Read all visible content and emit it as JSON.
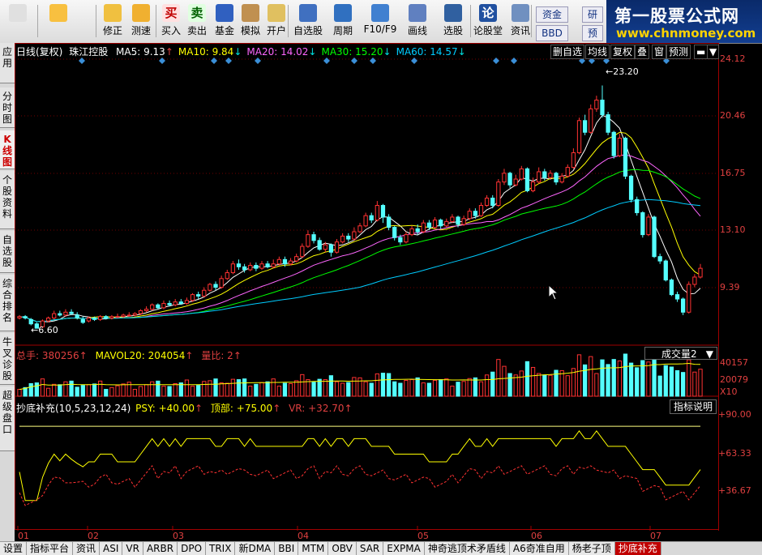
{
  "toolbar": {
    "buttons": [
      {
        "label": "",
        "icon": "home-icon"
      },
      {
        "label": "",
        "icon": "back-arrow-icon"
      },
      {
        "label": "修正",
        "icon": "up-down-arrows-icon"
      },
      {
        "label": "测速",
        "icon": "speed-dial-icon"
      },
      {
        "label": "买入",
        "icon": "buy-icon",
        "glyph": "买"
      },
      {
        "label": "卖出",
        "icon": "sell-icon",
        "glyph": "卖"
      },
      {
        "label": "基金",
        "icon": "fund-icon"
      },
      {
        "label": "模拟",
        "icon": "hammer-icon"
      },
      {
        "label": "开户",
        "icon": "lock-icon"
      },
      {
        "label": "自选股",
        "icon": "star-icon"
      },
      {
        "label": "周期",
        "icon": "clock-icon"
      },
      {
        "label": "F10/F9",
        "icon": "f10-icon"
      },
      {
        "label": "画线",
        "icon": "pencil-icon"
      },
      {
        "label": "选股",
        "icon": "screen-icon"
      },
      {
        "label": "论股堂",
        "icon": "forum-icon",
        "glyph": "论"
      },
      {
        "label": "资讯",
        "icon": "news-icon"
      }
    ],
    "chips": [
      "资金",
      "BBD",
      "研",
      "预"
    ]
  },
  "brand": {
    "title": "第一股票公式网",
    "url": "www.chnmoney.com"
  },
  "left_tabs": [
    "应用",
    "分时图",
    "K线图",
    "个股资料",
    "自选股",
    "综合排名",
    "牛叉诊股",
    "超级盘口"
  ],
  "main_panel": {
    "title": "日线(复权)",
    "stock": "珠江控股",
    "ma": [
      {
        "label": "MA5: 9.13",
        "color": "#ffffff"
      },
      {
        "label": "MA10: 9.84",
        "color": "#ffff00"
      },
      {
        "label": "MA20: 14.02",
        "color": "#ff66ff"
      },
      {
        "label": "MA30: 15.20",
        "color": "#00ff00"
      },
      {
        "label": "MA60: 14.57",
        "color": "#00ccff"
      }
    ],
    "options": [
      "删自选",
      "均线",
      "复权",
      "叠",
      "窗",
      "预测"
    ],
    "high_label": "23.20",
    "low_label": "6.60",
    "y_ticks": [
      "24.12",
      "20.46",
      "16.75",
      "13.10",
      "9.39"
    ]
  },
  "volume_panel": {
    "total": "总手: 380256",
    "mavol": "MAVOL20: 204054",
    "ratio": "量比: 2",
    "dropdown": "成交量2",
    "y_ticks": [
      "40157",
      "20079",
      "X10"
    ]
  },
  "indicator_panel": {
    "name": "抄底补充(10,5,23,12,24)",
    "psy": "PSY: +40.00",
    "top": "顶部: +75.00",
    "vr": "VR: +32.70",
    "help": "指标说明",
    "y_ticks": [
      "+90.00",
      "+63.33",
      "+36.67"
    ]
  },
  "x_labels": [
    "01",
    "02",
    "03",
    "04",
    "05",
    "06",
    "07"
  ],
  "bottom_tabs": [
    "设置",
    "指标平台",
    "资讯",
    "ASI",
    "VR",
    "ARBR",
    "DPO",
    "TRIX",
    "新DMA",
    "BBI",
    "MTM",
    "OBV",
    "SAR",
    "EXPMA",
    "神奇逃顶术矛盾线",
    "A6奇准自用",
    "杨老子顶",
    "抄底补充"
  ],
  "active_bottom_tab": "抄底补充",
  "chart_data": {
    "type": "candlestick",
    "ylim": [
      5.5,
      25.0
    ],
    "candles": [
      [
        7.3,
        7.4,
        7.5,
        7.2
      ],
      [
        7.4,
        7.3,
        7.5,
        7.2
      ],
      [
        7.2,
        6.9,
        7.3,
        6.8
      ],
      [
        6.9,
        6.6,
        7.0,
        6.6
      ],
      [
        6.7,
        7.1,
        7.2,
        6.6
      ],
      [
        7.1,
        7.3,
        7.4,
        7.0
      ],
      [
        7.3,
        7.6,
        7.8,
        7.2
      ],
      [
        7.6,
        7.5,
        7.8,
        7.4
      ],
      [
        7.5,
        7.7,
        7.9,
        7.4
      ],
      [
        7.7,
        7.6,
        7.9,
        7.5
      ],
      [
        7.5,
        7.3,
        7.7,
        7.2
      ],
      [
        7.2,
        7.0,
        7.4,
        6.9
      ],
      [
        7.1,
        7.3,
        7.4,
        7.0
      ],
      [
        7.3,
        7.2,
        7.4,
        7.1
      ],
      [
        7.2,
        7.4,
        7.5,
        7.1
      ],
      [
        7.4,
        7.3,
        7.5,
        7.2
      ],
      [
        7.3,
        7.4,
        7.5,
        7.2
      ],
      [
        7.4,
        7.4,
        7.6,
        7.3
      ],
      [
        7.4,
        7.5,
        7.6,
        7.3
      ],
      [
        7.5,
        7.5,
        7.7,
        7.4
      ],
      [
        7.5,
        7.6,
        7.7,
        7.4
      ],
      [
        7.6,
        7.8,
        7.9,
        7.5
      ],
      [
        7.8,
        7.9,
        8.1,
        7.7
      ],
      [
        7.9,
        8.2,
        8.3,
        7.8
      ],
      [
        8.2,
        8.0,
        8.3,
        7.9
      ],
      [
        8.0,
        8.3,
        8.5,
        7.9
      ],
      [
        8.3,
        8.2,
        8.5,
        8.1
      ],
      [
        8.2,
        8.4,
        8.6,
        8.1
      ],
      [
        8.4,
        8.3,
        8.6,
        8.2
      ],
      [
        8.3,
        8.5,
        8.7,
        8.2
      ],
      [
        8.5,
        8.9,
        9.0,
        8.4
      ],
      [
        8.9,
        8.8,
        9.1,
        8.6
      ],
      [
        8.8,
        9.2,
        9.4,
        8.7
      ],
      [
        9.2,
        9.6,
        9.7,
        9.1
      ],
      [
        9.6,
        9.4,
        9.8,
        9.2
      ],
      [
        9.4,
        10.0,
        10.2,
        9.3
      ],
      [
        10.0,
        10.4,
        10.6,
        9.9
      ],
      [
        10.4,
        11.0,
        11.2,
        10.3
      ],
      [
        11.0,
        10.8,
        11.3,
        10.6
      ],
      [
        10.8,
        10.6,
        11.0,
        10.4
      ],
      [
        10.6,
        10.9,
        11.1,
        10.5
      ],
      [
        10.9,
        10.7,
        11.1,
        10.5
      ],
      [
        10.7,
        11.0,
        11.2,
        10.6
      ],
      [
        11.0,
        10.8,
        11.2,
        10.7
      ],
      [
        10.8,
        11.0,
        11.3,
        10.7
      ],
      [
        11.0,
        11.3,
        11.5,
        10.9
      ],
      [
        11.3,
        11.0,
        11.5,
        10.8
      ],
      [
        11.0,
        11.2,
        11.4,
        10.9
      ],
      [
        11.2,
        11.5,
        11.7,
        11.1
      ],
      [
        11.5,
        12.2,
        12.4,
        11.4
      ],
      [
        12.2,
        13.0,
        13.3,
        12.1
      ],
      [
        13.0,
        12.6,
        13.2,
        12.4
      ],
      [
        12.6,
        12.0,
        12.8,
        11.9
      ],
      [
        12.0,
        12.3,
        12.5,
        11.8
      ],
      [
        12.3,
        11.8,
        12.4,
        11.5
      ],
      [
        11.8,
        12.5,
        12.7,
        11.7
      ],
      [
        12.5,
        12.9,
        13.1,
        12.4
      ],
      [
        12.9,
        12.7,
        13.1,
        12.5
      ],
      [
        12.7,
        13.2,
        13.5,
        12.6
      ],
      [
        13.2,
        13.6,
        13.8,
        13.1
      ],
      [
        13.6,
        14.3,
        14.5,
        13.5
      ],
      [
        14.3,
        14.0,
        14.5,
        13.8
      ],
      [
        14.0,
        15.0,
        15.3,
        13.9
      ],
      [
        15.0,
        14.2,
        15.1,
        13.8
      ],
      [
        14.2,
        13.5,
        14.4,
        13.3
      ],
      [
        13.5,
        12.8,
        13.6,
        12.6
      ],
      [
        12.8,
        12.5,
        13.0,
        12.3
      ],
      [
        12.5,
        13.0,
        13.2,
        12.4
      ],
      [
        13.0,
        13.4,
        13.6,
        12.9
      ],
      [
        13.4,
        13.2,
        13.7,
        13.0
      ],
      [
        13.2,
        13.8,
        14.0,
        13.1
      ],
      [
        13.8,
        13.5,
        14.0,
        13.3
      ],
      [
        13.5,
        14.0,
        14.2,
        13.4
      ],
      [
        14.0,
        13.6,
        14.1,
        13.4
      ],
      [
        13.6,
        13.9,
        14.1,
        13.5
      ],
      [
        13.9,
        14.2,
        14.4,
        13.8
      ],
      [
        14.2,
        13.7,
        14.3,
        13.5
      ],
      [
        13.7,
        14.1,
        14.3,
        13.6
      ],
      [
        14.1,
        14.6,
        14.8,
        14.0
      ],
      [
        14.6,
        14.3,
        14.8,
        14.1
      ],
      [
        14.3,
        15.0,
        15.2,
        14.2
      ],
      [
        15.0,
        15.5,
        15.7,
        14.9
      ],
      [
        15.5,
        15.0,
        15.7,
        14.8
      ],
      [
        15.0,
        16.6,
        16.8,
        14.9
      ],
      [
        16.6,
        17.2,
        17.5,
        16.4
      ],
      [
        17.2,
        16.4,
        17.3,
        16.2
      ],
      [
        16.4,
        16.8,
        17.1,
        16.3
      ],
      [
        16.8,
        17.5,
        17.7,
        16.7
      ],
      [
        17.5,
        16.0,
        17.6,
        15.9
      ],
      [
        16.0,
        16.6,
        16.9,
        15.9
      ],
      [
        16.6,
        17.3,
        17.6,
        16.5
      ],
      [
        17.3,
        16.9,
        17.5,
        16.7
      ],
      [
        16.9,
        17.2,
        17.4,
        16.8
      ],
      [
        17.2,
        16.6,
        17.3,
        16.4
      ],
      [
        16.6,
        17.0,
        17.2,
        16.5
      ],
      [
        17.0,
        17.6,
        17.8,
        16.9
      ],
      [
        17.6,
        18.6,
        18.9,
        17.5
      ],
      [
        18.6,
        20.8,
        21.0,
        18.5
      ],
      [
        20.8,
        20.0,
        21.2,
        19.8
      ],
      [
        20.0,
        21.6,
        21.9,
        19.9
      ],
      [
        21.6,
        22.2,
        22.5,
        21.4
      ],
      [
        22.2,
        21.2,
        23.2,
        21.0
      ],
      [
        21.2,
        20.0,
        21.4,
        19.8
      ],
      [
        20.0,
        18.4,
        20.1,
        18.2
      ],
      [
        18.4,
        19.6,
        19.9,
        18.3
      ],
      [
        19.6,
        17.0,
        19.7,
        16.8
      ],
      [
        17.0,
        15.4,
        17.1,
        15.2
      ],
      [
        15.4,
        14.5,
        15.6,
        14.3
      ],
      [
        14.5,
        13.0,
        14.6,
        12.8
      ],
      [
        13.0,
        14.2,
        14.4,
        12.9
      ],
      [
        14.2,
        11.5,
        14.3,
        11.4
      ],
      [
        11.5,
        11.2,
        11.7,
        11.0
      ],
      [
        11.2,
        9.9,
        11.3,
        9.8
      ],
      [
        9.9,
        8.9,
        10.0,
        8.8
      ],
      [
        8.9,
        8.6,
        9.1,
        8.4
      ],
      [
        8.6,
        7.7,
        8.7,
        7.5
      ],
      [
        7.7,
        9.6,
        9.8,
        7.6
      ],
      [
        9.6,
        10.1,
        10.3,
        9.4
      ],
      [
        10.1,
        10.7,
        11.0,
        10.0
      ]
    ],
    "ma_periods": [
      5,
      10,
      20,
      30,
      60
    ],
    "indicator": {
      "upper": 90,
      "lower": 36.67,
      "mid": 63.33,
      "ymin": 27,
      "ymax": 96,
      "ref_line": 82
    }
  }
}
